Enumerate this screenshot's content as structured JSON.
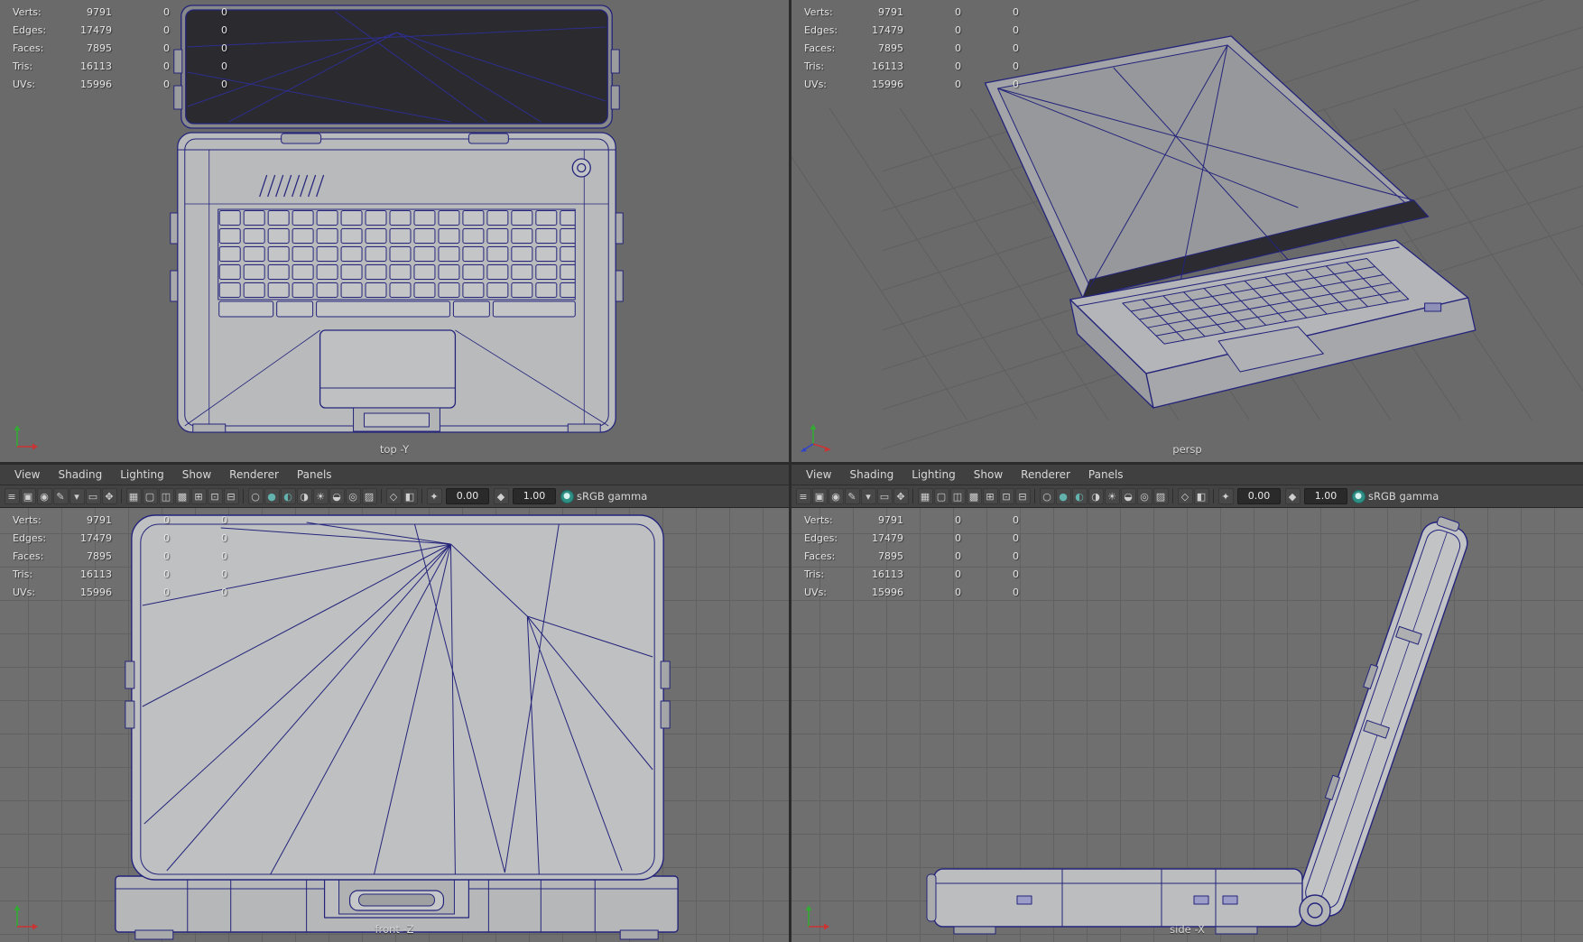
{
  "hud": {
    "rows": [
      {
        "label": "Verts:",
        "value": "9791",
        "c1": "0",
        "c2": "0"
      },
      {
        "label": "Edges:",
        "value": "17479",
        "c1": "0",
        "c2": "0"
      },
      {
        "label": "Faces:",
        "value": "7895",
        "c1": "0",
        "c2": "0"
      },
      {
        "label": "Tris:",
        "value": "16113",
        "c1": "0",
        "c2": "0"
      },
      {
        "label": "UVs:",
        "value": "15996",
        "c1": "0",
        "c2": "0"
      }
    ]
  },
  "menus": [
    "View",
    "Shading",
    "Lighting",
    "Show",
    "Renderer",
    "Panels"
  ],
  "viewports": {
    "top": {
      "label": "top -Y"
    },
    "persp": {
      "label": "persp"
    },
    "front": {
      "label": "front -Z"
    },
    "side": {
      "label": "side -X"
    }
  },
  "toolbar": {
    "exposure": "0.00",
    "gamma": "1.00",
    "colorspace": "sRGB gamma",
    "icons": [
      {
        "n": "panel-menu",
        "g": "≡"
      },
      {
        "n": "camera-select",
        "g": "▣"
      },
      {
        "n": "camera-lock",
        "g": "◉"
      },
      {
        "n": "camera-attributes",
        "g": "✎"
      },
      {
        "n": "bookmarks",
        "g": "▾"
      },
      {
        "n": "image-plane",
        "g": "▭"
      },
      {
        "n": "two-d-pan-zoom",
        "g": "✥"
      },
      {
        "sep": true
      },
      {
        "n": "grid",
        "g": "▦"
      },
      {
        "n": "film-gate",
        "g": "▢"
      },
      {
        "n": "resolution-gate",
        "g": "◫"
      },
      {
        "n": "gate-mask",
        "g": "▩"
      },
      {
        "n": "field-chart",
        "g": "⊞"
      },
      {
        "n": "safe-action",
        "g": "⊡"
      },
      {
        "n": "safe-title",
        "g": "⊟"
      },
      {
        "sep": true
      },
      {
        "n": "wireframe",
        "g": "○"
      },
      {
        "n": "smooth-shade",
        "g": "●",
        "c": "#62b3ae"
      },
      {
        "n": "material-override",
        "g": "◐",
        "c": "#62b3ae"
      },
      {
        "n": "textured",
        "g": "◑"
      },
      {
        "n": "use-all-lights",
        "g": "☀"
      },
      {
        "n": "shadows",
        "g": "◒"
      },
      {
        "n": "occlusion",
        "g": "◎"
      },
      {
        "n": "anti-alias",
        "g": "▨"
      },
      {
        "sep": true
      },
      {
        "n": "xray",
        "g": "◇"
      },
      {
        "n": "isolate-select",
        "g": "◧"
      },
      {
        "sep": true
      },
      {
        "n": "exposure",
        "g": "✦",
        "field": "exposure"
      },
      {
        "n": "gamma",
        "g": "◆",
        "field": "gamma"
      },
      {
        "n": "color-management",
        "g": "●",
        "round": true
      },
      {
        "n": "colorspace",
        "field": "colorspace",
        "plain": true
      }
    ]
  },
  "colors": {
    "wireframe": "#24247b",
    "viewport_bg": "#6f6f6f",
    "grid_line": "#616161",
    "model_body": "#b9babc",
    "screen_dark": "#2a2a2f",
    "accent_teal": "#2e8f85",
    "axis_x": "#cc3333",
    "axis_y": "#33aa33",
    "axis_z": "#3344cc"
  }
}
